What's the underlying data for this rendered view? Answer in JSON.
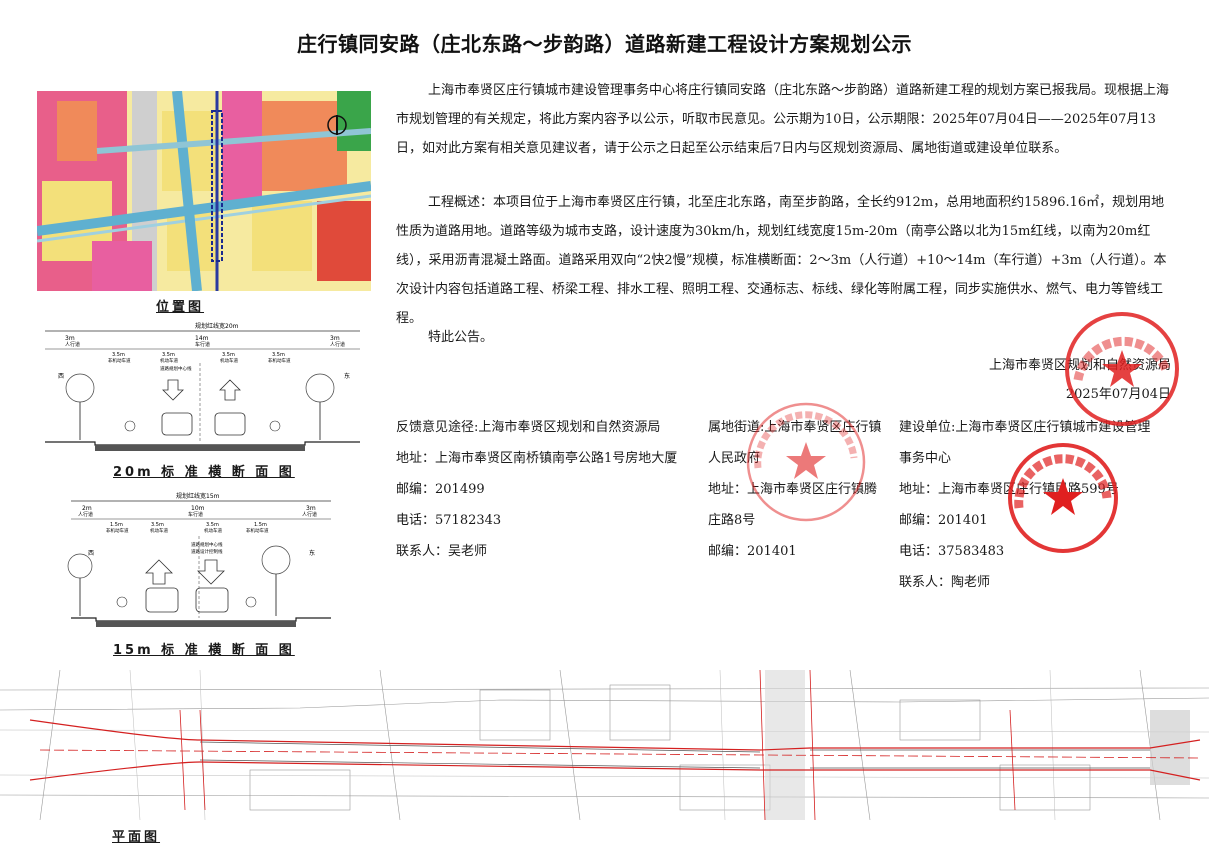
{
  "title": "庄行镇同安路（庄北东路～步韵路）道路新建工程设计方案规划公示",
  "notice": {
    "p1": "上海市奉贤区庄行镇城市建设管理事务中心将庄行镇同安路（庄北东路～步韵路）道路新建工程的规划方案已报我局。现根据上海市规划管理的有关规定，将此方案内容予以公示，听取市民意见。公示期为10日，公示期限：2025年07月04日——2025年07月13日，如对此方案有相关意见建议者，请于公示之日起至公示结束后7日内与区规划资源局、属地街道或建设单位联系。",
    "p2": "工程概述：本项目位于上海市奉贤区庄行镇，北至庄北东路，南至步韵路，全长约912m，总用地面积约15896.16㎡，规划用地性质为道路用地。道路等级为城市支路，设计速度为30km/h，规划红线宽度15m-20m（南亭公路以北为15m红线，以南为20m红线），采用沥青混凝土路面。道路采用双向“2快2慢”规模，标准横断面：2～3m（人行道）+10～14m（车行道）+3m（人行道）。本次设计内容包括道路工程、桥梁工程、排水工程、照明工程、交通标志、标线、绿化等附属工程，同步实施供水、燃气、电力等管线工程。",
    "p3": "特此公告。",
    "sign_org": "上海市奉贤区规划和自然资源局",
    "sign_date": "2025年07月04日"
  },
  "contacts": {
    "feedback": {
      "l1": "反馈意见途径:上海市奉贤区规划和自然资源局",
      "l2": "地址：上海市奉贤区南桥镇南亭公路1号房地大厦",
      "l3": "邮编：201499",
      "l4": "电话：57182343",
      "l5": "联系人：吴老师"
    },
    "street": {
      "l1": "属地街道:上海市奉贤区庄行镇",
      "l2": "人民政府",
      "l3": "地址：上海市奉贤区庄行镇腾",
      "l4": "庄路8号",
      "l5": "邮编：201401"
    },
    "builder": {
      "l1": "建设单位:上海市奉贤区庄行镇城市建设管理",
      "l2": "事务中心",
      "l3": "地址：上海市奉贤区庄行镇",
      "l3b": "民路599号",
      "l4": "邮编：201401",
      "l5": "电话：37583483",
      "l6": "联系人：陶老师"
    }
  },
  "figures": {
    "location_caption": "位置图",
    "section20_caption": "20m 标 准 横 断 面 图",
    "section15_caption": "15m 标 准 横 断 面 图",
    "plan_caption": "平面图",
    "s20": {
      "total": "规划红线宽20m",
      "w3": "3m",
      "w14": "14m",
      "sidewalk": "人行道",
      "carriage": "车行道",
      "w35": "3.5m",
      "nonmotor": "非机动车道",
      "motor": "机动车道",
      "west": "西",
      "east": "东",
      "centerline": "道路规划中心线"
    },
    "s15": {
      "total": "规划红线宽15m",
      "w2": "2m",
      "w10": "10m",
      "w3": "3m",
      "w15": "1.5m",
      "w35": "3.5m",
      "sidewalk": "人行道",
      "carriage": "车行道",
      "nonmotor": "非机动车道",
      "motor": "机动车道",
      "west": "西",
      "east": "东",
      "centerline": "道路规划中心线",
      "designline": "道路设计控制线"
    },
    "stamps": {
      "bureau": "上海市奉贤区规划和自然资源局",
      "town": "上海市奉贤区庄行镇人民政府",
      "center": "上海市奉贤区庄行镇城市建设管理事务中心"
    }
  },
  "colors": {
    "stamp": "#e02020",
    "road_red": "#d42020",
    "site_green": "#3a9a3a",
    "yellow_land": "#f3e07a",
    "orange_land": "#f08a5a",
    "pink_land": "#e85fa0"
  }
}
